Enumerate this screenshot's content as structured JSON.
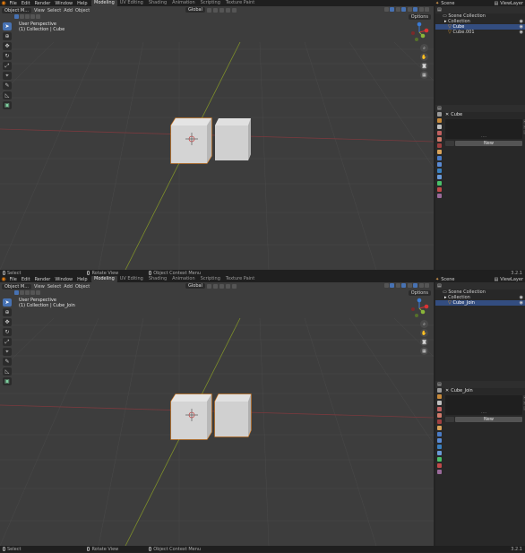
{
  "menu": [
    "File",
    "Edit",
    "Render",
    "Window",
    "Help"
  ],
  "workspace_tabs": [
    "Modeling",
    "UV Editing",
    "Shading",
    "Animation",
    "Scripting",
    "Texture Paint"
  ],
  "active_tab": "Modeling",
  "scene_label": "Scene",
  "viewlayer_label": "ViewLayer",
  "viewport_header": {
    "mode": "Object M...",
    "menus": [
      "View",
      "Select",
      "Add",
      "Object"
    ],
    "orientation": "Global",
    "options": "Options"
  },
  "perspective_label": "User Perspective",
  "status": {
    "select": "Select",
    "rotate": "Rotate View",
    "context": "Object Context Menu",
    "version": "3.2.1"
  },
  "colors": {
    "accent_orange": "#e87d0d",
    "selection_blue": "#4772b3",
    "x_axis": "#b3383f",
    "y_axis": "#8aab2d"
  },
  "top": {
    "collection_label": "(1) Collection | Cube",
    "outliner": {
      "root": "Scene Collection",
      "collection": "Collection",
      "items": [
        "Cube",
        "Cube.001"
      ]
    },
    "props_object": "Cube",
    "new_button": "New"
  },
  "bottom": {
    "collection_label": "(1) Collection | Cube_Join",
    "outliner": {
      "root": "Scene Collection",
      "collection": "Collection",
      "items": [
        "Cube_Join"
      ]
    },
    "props_object": "Cube_Join",
    "new_button": "New"
  }
}
